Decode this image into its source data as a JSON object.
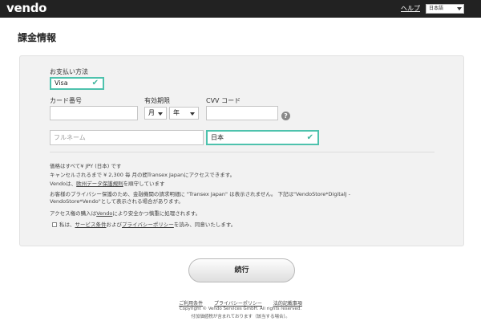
{
  "header": {
    "logo": "vendo",
    "help_label": "ヘルプ",
    "language": "日本語"
  },
  "page_title": "課金情報",
  "form": {
    "payment_method_label": "お支払い方法",
    "payment_method_value": "Visa",
    "card_number_label": "カード番号",
    "card_number_value": "",
    "expiry_label": "有効期限",
    "month_value": "月",
    "year_value": "年",
    "cvv_label": "CVV コード",
    "cvv_value": "",
    "fullname_placeholder": "フルネーム",
    "country_value": "日本"
  },
  "info": {
    "line1": "価格はすべて¥ JPY (日本) です",
    "line2": "キャンセルされるまで ¥ 2,300 毎 月の間Transex Japanにアクセスできます。",
    "line3_pre": "Vendoは、",
    "line3_link": "欧州データ保護規則",
    "line3_post": "を順守しています",
    "line4": "お客様のプライバシー保護のため、金融機関の請求明細に \"Transex Japan\" は表示されません。 下記は\"VendoStore*DigitalJ -",
    "line5": "VendoStore*Vendo\"として表示される場合があります。",
    "line6_pre": "アクセス権の購入は",
    "line6_link": "Vendo",
    "line6_post": "により安全かつ慎重に処理されます。",
    "line7_pre": "私は、",
    "line7_link1": "サービス条件",
    "line7_mid": "および",
    "line7_link2": "プライバシーポリシー",
    "line7_post": "を読み、同意いたします。"
  },
  "continue_label": "続行",
  "footer": {
    "link1": "ご利用条件",
    "link2": "プライバシーポリシー",
    "link3": "法的記載事項",
    "copyright": "Copyright © Vendo Services GmbH. All rights reserved.",
    "vat_note": "付加価値税が含まれております（該当する場合）。"
  },
  "colors": {
    "topbar": "#222222",
    "valid_border": "#4ec2ad",
    "panel_bg": "#f2f2f2"
  }
}
